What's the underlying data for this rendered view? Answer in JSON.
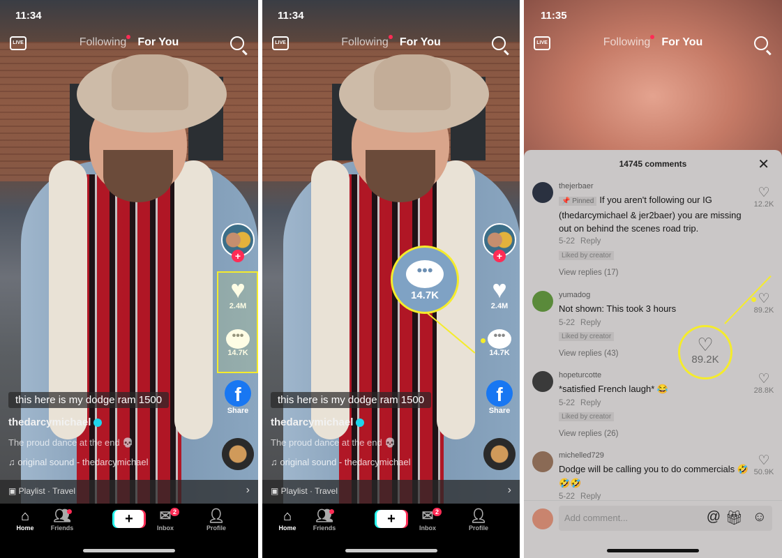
{
  "video": {
    "time": "11:34",
    "live": "LIVE",
    "following": "Following",
    "for_you": "For You",
    "likes": "2.4M",
    "comments": "14.7K",
    "comment_badge": "!",
    "share": "Share",
    "caption": "this here is my dodge ram 1500",
    "username": "thedarcymichael",
    "description": "The proud dance at the end 💀",
    "sound": "original sound - thedarcymichael",
    "playlist": "Playlist · Travel",
    "tabs": [
      {
        "label": "Home",
        "icon": "home-icon"
      },
      {
        "label": "Friends",
        "icon": "friends-icon"
      },
      {
        "label": "",
        "icon": "create-icon"
      },
      {
        "label": "Inbox",
        "icon": "inbox-icon",
        "badge": "2"
      },
      {
        "label": "Profile",
        "icon": "profile-icon"
      }
    ]
  },
  "callout_panel2": {
    "value": "14.7K"
  },
  "comments_panel": {
    "time": "11:35",
    "live": "LIVE",
    "following": "Following",
    "for_you": "For You",
    "title": "14745 comments",
    "pinned_label": "Pinned",
    "comments": [
      {
        "user": "thejerbaer",
        "text": "If you aren't following our IG (thedarcymichael & jer2baer) you are missing out on behind the scenes road trip.",
        "date": "5-22",
        "reply": "Reply",
        "liked_by_creator": "Liked by creator",
        "replies": "View replies (17)",
        "likes": "12.2K",
        "pinned": true
      },
      {
        "user": "yumadog",
        "text": "Not shown: This took 3 hours",
        "date": "5-22",
        "reply": "Reply",
        "liked_by_creator": "Liked by creator",
        "replies": "View replies (43)",
        "likes": "89.2K"
      },
      {
        "user": "hopeturcotte",
        "text": "*satisfied French laugh* 😂",
        "date": "5-22",
        "reply": "Reply",
        "liked_by_creator": "Liked by creator",
        "replies": "View replies (26)",
        "likes": "28.8K"
      },
      {
        "user": "michelled729",
        "text": "Dodge will be calling you to do commercials 🤣🤣🤣",
        "date": "5-22",
        "reply": "Reply",
        "likes": "50.9K"
      }
    ],
    "input_placeholder": "Add comment...",
    "callout_value": "89.2K"
  },
  "colors": {
    "highlight": "#f5ec2b",
    "accent": "#fe2c55"
  }
}
